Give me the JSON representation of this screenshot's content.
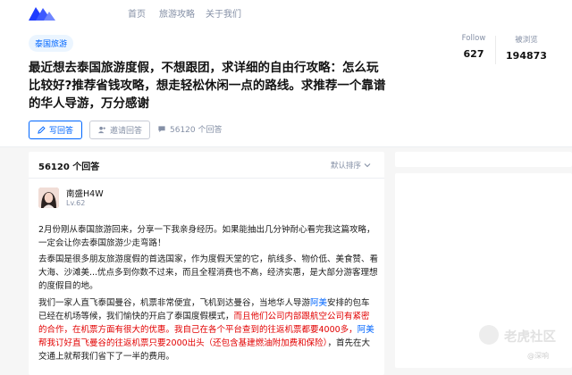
{
  "nav": {
    "items": [
      "首页",
      "旅游攻略",
      "关于我们"
    ]
  },
  "question": {
    "topic": "泰国旅游",
    "title": "最近想去泰国旅游度假，不想跟团，求详细的自由行攻略：怎么玩比较好?推荐省钱攻略，想走轻松休闲一点的路线。求推荐一个靠谱的华人导游，万分感谢",
    "follow_label": "Follow",
    "follow_count": "627",
    "views_label": "被浏览",
    "views_count": "194873",
    "write_button": "写回答",
    "invite_button": "邀请回答",
    "answer_count_button": "56120 个回答"
  },
  "answers": {
    "count_label": "56120 个回答",
    "sort_label": "默认排序",
    "author_name": "南盛H4W",
    "author_level": "Lv.62",
    "p1": "2月份刚从泰国旅游回来，分享一下我亲身经历。如果能抽出几分钟耐心看完我这篇攻略，一定会让你去泰国旅游少走弯路！",
    "p2": "去泰国是很多朋友旅游度假的首选国家，作为度假天堂的它，航线多、物价低、美食赞、看大海、沙滩美...优点多到你数不过来，而且全程消费也不高，经济实惠，是大部分游客理想的度假目的地。",
    "p3_a": "我们一家人直飞泰国曼谷，机票非常便宜，飞机到达曼谷，当地华人导游",
    "p3_b": "阿美",
    "p3_c": "安排的包车已经在机场等候，我们愉快的开启了泰国度假模式，",
    "p3_d": "而且他们公司内部跟航空公司有紧密的合作，在机票方面有很大的优惠。我自己在各个平台查到的往返机票都要4000多，",
    "p3_e": "阿美",
    "p3_f": "帮我订好直飞曼谷的往返机票只要2000出头（还包含基建燃油附加费和保险）",
    "p3_g": "，首先在大交通上就帮我们省下了一半的费用。"
  },
  "watermark": {
    "text": "老虎社区",
    "sub": "@深响"
  },
  "colors": {
    "accent": "#0066ff",
    "highlight": "#e20000"
  }
}
